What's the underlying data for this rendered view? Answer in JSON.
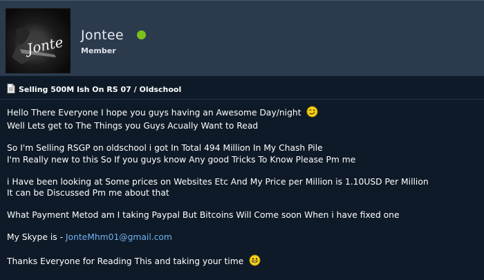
{
  "author": {
    "username": "Jontee",
    "role": "Member",
    "avatar_text": "Jonte",
    "status": "online",
    "status_color": "#7cc01c"
  },
  "post": {
    "title": "Selling 500M Ish On RS 07 / Oldschool",
    "lines": {
      "l1": "Hello There Everyone I hope you guys having an Awesome Day/night",
      "l2": "Well Lets get to The Things you Guys Acually Want to Read",
      "l3": "So I'm Selling RSGP on oldschool i got In Total 494 Million In My Chash Pile",
      "l4": "I'm Really new to this So If you guys know Any good Tricks To Know Please Pm me",
      "l5": "i Have been looking at Some prices on Websites Etc And My Price per Million is 1.10USD Per Million",
      "l6": "It can be Discussed Pm me about that",
      "l7": "What Payment Metod am I taking Paypal But Bitcoins Will Come soon When i have fixed one",
      "l8_prefix": "My Skype is - ",
      "l8_link": "JonteMhm01@gmail.com",
      "l9": "Thanks Everyone for Reading This and taking your time"
    },
    "icons": {
      "title_icon": "document-icon",
      "smiley1": "wink-smiley-icon",
      "smiley2": "grin-smiley-icon"
    }
  },
  "colors": {
    "header_bg": "#2b3a4d",
    "page_bg": "#0e1a27",
    "link": "#6fb2f2"
  }
}
